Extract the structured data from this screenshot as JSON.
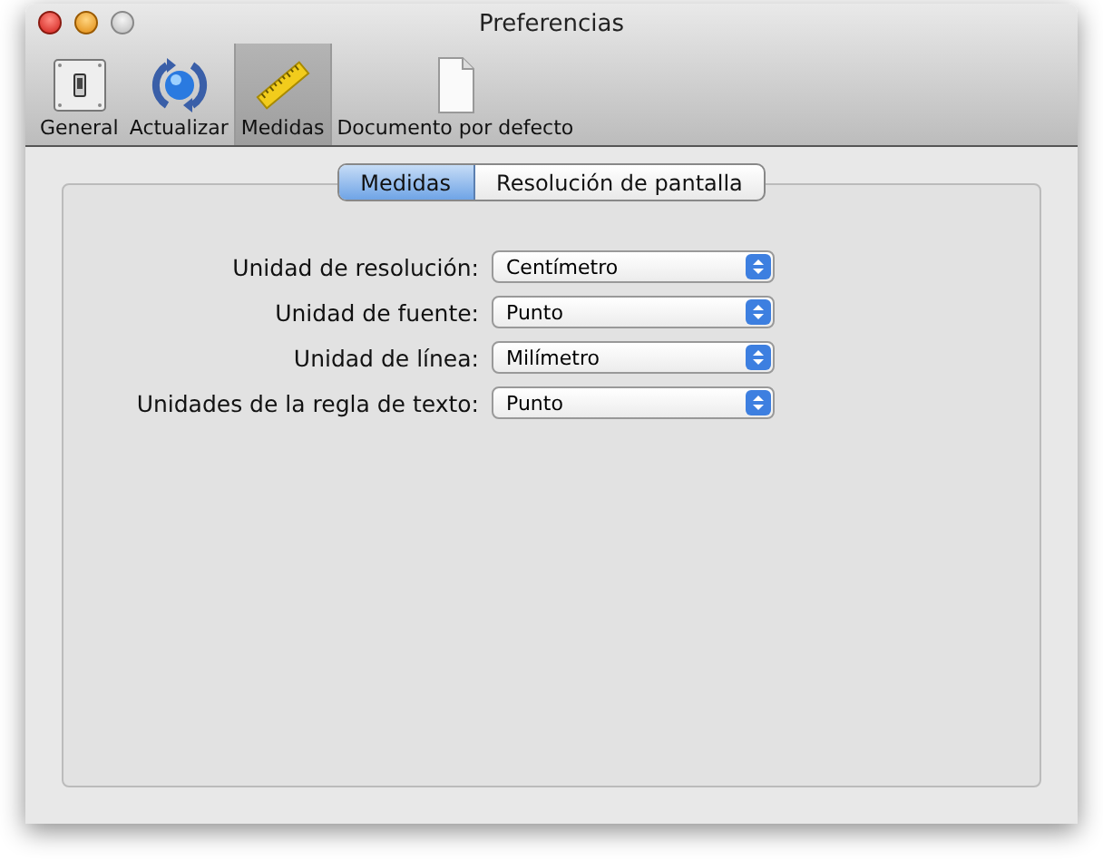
{
  "window": {
    "title": "Preferencias"
  },
  "toolbar": [
    {
      "label": "General",
      "kind": "switch",
      "selected": false
    },
    {
      "label": "Actualizar",
      "kind": "sync",
      "selected": false
    },
    {
      "label": "Medidas",
      "kind": "ruler",
      "selected": true
    },
    {
      "label": "Documento por defecto",
      "kind": "document",
      "selected": false
    }
  ],
  "tabs": [
    {
      "label": "Medidas",
      "selected": true
    },
    {
      "label": "Resolución de pantalla",
      "selected": false
    }
  ],
  "fields": [
    {
      "label": "Unidad de resolución:",
      "value": "Centímetro"
    },
    {
      "label": "Unidad de fuente:",
      "value": "Punto"
    },
    {
      "label": "Unidad de línea:",
      "value": "Milímetro"
    },
    {
      "label": "Unidades de la regla de texto:",
      "value": "Punto"
    }
  ]
}
